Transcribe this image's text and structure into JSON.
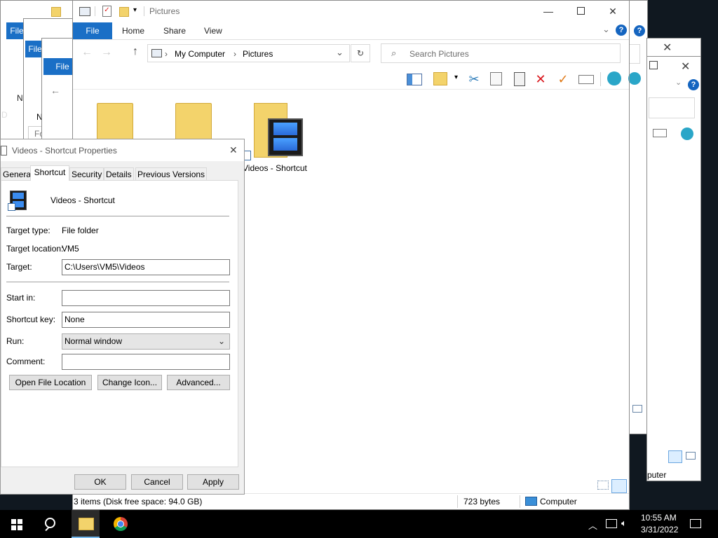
{
  "background_windows": {
    "file_tab_label": "File",
    "folder_options_label": "Folder Op",
    "left_letters": [
      "N",
      "N",
      "D"
    ],
    "partial_text": "puter"
  },
  "explorer": {
    "title": "Pictures",
    "tabs": [
      "File",
      "Home",
      "Share",
      "View"
    ],
    "address": {
      "root": "My Computer",
      "folder": "Pictures"
    },
    "search_placeholder": "Search Pictures",
    "items": [
      {
        "name": ""
      },
      {
        "name": ""
      },
      {
        "name": "Videos - Shortcut"
      }
    ],
    "status": {
      "items_text": "3 items (Disk free space: 94.0 GB)",
      "size_text": "723 bytes",
      "location_text": "Computer"
    }
  },
  "properties": {
    "title": "Videos - Shortcut Properties",
    "tabs": [
      "General",
      "Shortcut",
      "Security",
      "Details",
      "Previous Versions"
    ],
    "active_tab": "Shortcut",
    "shortcut_name": "Videos - Shortcut",
    "target_type_label": "Target type:",
    "target_type_value": "File folder",
    "target_location_label": "Target location:",
    "target_location_value": "VM5",
    "target_label": "Target:",
    "target_value": "C:\\Users\\VM5\\Videos",
    "start_in_label": "Start in:",
    "start_in_value": "",
    "shortcut_key_label": "Shortcut key:",
    "shortcut_key_value": "None",
    "run_label": "Run:",
    "run_value": "Normal window",
    "comment_label": "Comment:",
    "comment_value": "",
    "buttons": {
      "open_file_location": "Open File Location",
      "change_icon": "Change Icon...",
      "advanced": "Advanced...",
      "ok": "OK",
      "cancel": "Cancel",
      "apply": "Apply"
    }
  },
  "taskbar": {
    "time": "10:55 AM",
    "date": "3/31/2022"
  },
  "colors": {
    "file_tab": "#1a6fc6",
    "help": "#1565c0",
    "delete_red": "#d9161c",
    "check_orange": "#e07b1a"
  }
}
